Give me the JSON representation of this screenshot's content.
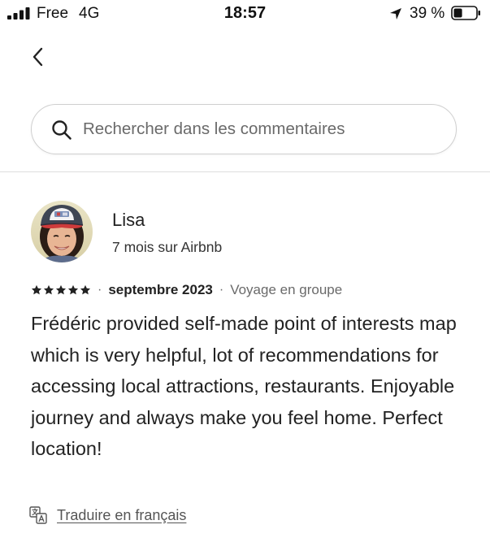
{
  "status_bar": {
    "carrier": "Free",
    "network": "4G",
    "time": "18:57",
    "battery_percent": "39 %",
    "battery_level": 0.39
  },
  "search": {
    "placeholder": "Rechercher dans les commentaires"
  },
  "review": {
    "reviewer_name": "Lisa",
    "reviewer_tenure": "7 mois sur Airbnb",
    "rating": 5,
    "separator": "·",
    "date": "septembre 2023",
    "trip_type": "Voyage en groupe",
    "text": "Frédéric provided self-made point of interests map which is very helpful, lot of recommendations for accessing local attractions, restaurants. Enjoyable journey and always make you feel home. Perfect location!",
    "translate_label": "Traduire en français"
  },
  "icons": {
    "back": "chevron-left-icon",
    "search": "search-icon",
    "translate": "translate-icon",
    "star": "star-icon",
    "location": "location-arrow-icon"
  }
}
